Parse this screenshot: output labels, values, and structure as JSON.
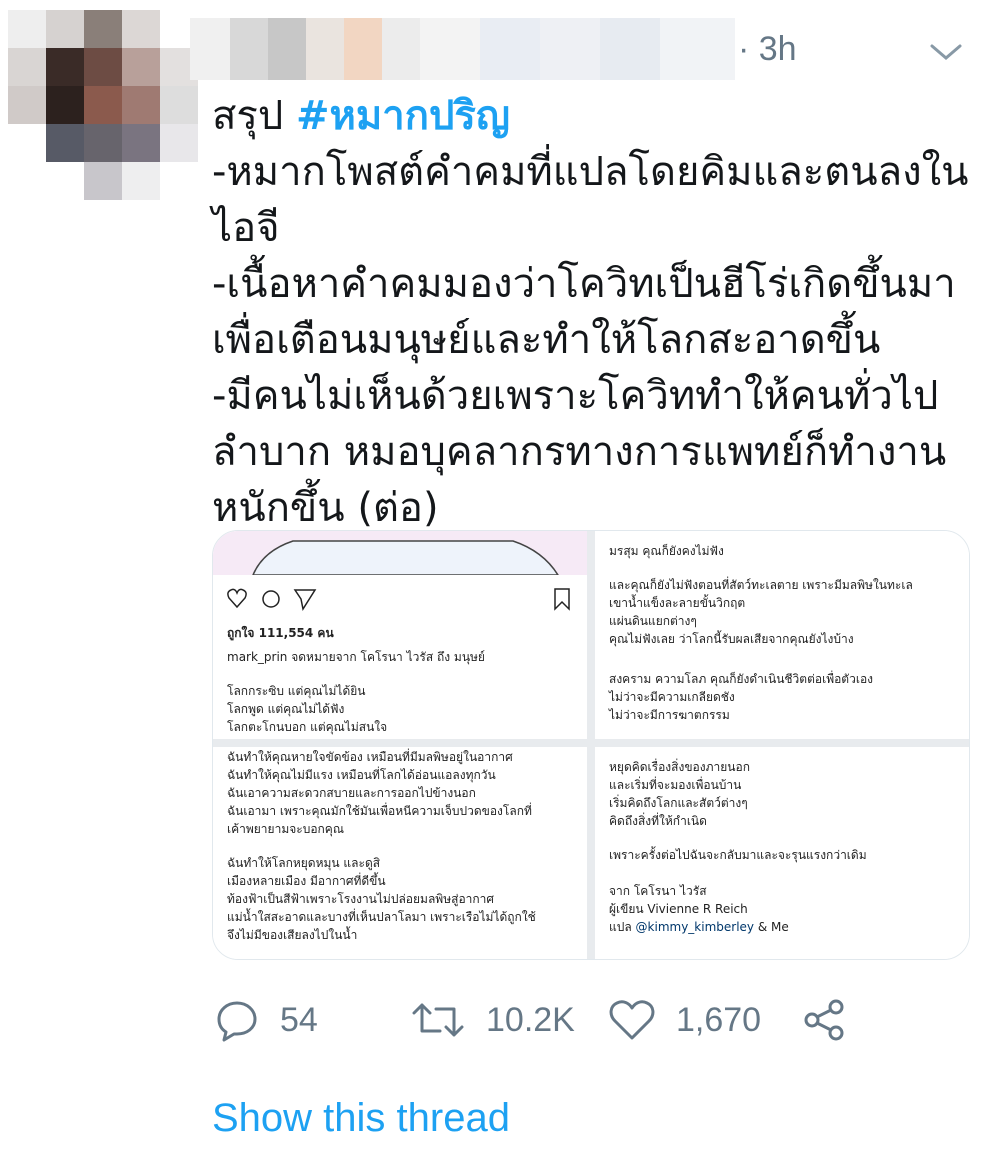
{
  "tweet": {
    "time": "· 3h",
    "text_prefix": "สรุป ",
    "hashtag": "#หมากปริญ",
    "lines": [
      "-หมากโพสต์คำคมที่แปลโดยคิมและตนลงใน",
      "ไอจี",
      "-เนื้อหาคำคมมองว่าโควิทเป็นฮีโร่เกิดขึ้นมา",
      "เพื่อเตือนมนุษย์และทำให้โลกสะอาดขึ้น",
      "-มีคนไม่เห็นด้วยเพราะโควิททำให้คนทั่วไป",
      "ลำบาก หมอบุคลากรทางการแพทย์ก็ทำงาน",
      "หนักขึ้น (ต่อ)"
    ]
  },
  "media": {
    "panel1": {
      "likes": "ถูกใจ 111,554 คน",
      "caption": "mark_prin จดหมายจาก โคโรนา ไวรัส ถึง มนุษย์",
      "lines": [
        "โลกกระซิบ แต่คุณไม่ได้ยิน",
        "โลกพูด แต่คุณไม่ได้ฟัง",
        "โลกตะโกนบอก แต่คุณไม่สนใจ"
      ]
    },
    "panel2": {
      "lines": [
        "มรสุม คุณก็ยังคงไม่ฟัง",
        "",
        "และคุณก็ยังไม่ฟังตอนที่สัตว์ทะเลตาย เพราะมีมลพิษในทะเล",
        "เขาน้ำแข็งละลายขั้นวิกฤต",
        "แผ่นดินแยกต่างๆ",
        "คุณไม่ฟังเลย ว่าโลกนี้รับผลเสียจากคุณยังไงบ้าง",
        "",
        "สงคราม ความโลภ คุณก็ยังดำเนินชีวิตต่อเพื่อตัวเอง",
        "ไม่ว่าจะมีความเกลียดชัง",
        "ไม่ว่าจะมีการฆาตกรรม"
      ]
    },
    "panel3": {
      "lines": [
        "ฉันทำให้คุณหายใจขัดข้อง เหมือนที่มีมลพิษอยู่ในอากาศ",
        "ฉันทำให้คุณไม่มีแรง เหมือนที่โลกได้อ่อนแอลงทุกวัน",
        "ฉันเอาความสะดวกสบายและการออกไปข้างนอก",
        "ฉันเอามา เพราะคุณมักใช้มันเพื่อหนีความเจ็บปวดของโลกที่",
        "เค้าพยายามจะบอกคุณ",
        "",
        "ฉันทำให้โลกหยุดหมุน และดูสิ",
        "เมืองหลายเมือง มีอากาศที่ดีขึ้น",
        "ท้องฟ้าเป็นสีฟ้าเพราะโรงงานไม่ปล่อยมลพิษสู่อากาศ",
        "แม่น้ำใสสะอาดและบางที่เห็นปลาโลมา เพราะเรือไม่ได้ถูกใช้",
        "จึงไม่มีของเสียลงไปในน้ำ"
      ]
    },
    "panel4": {
      "lines": [
        "หยุดคิดเรื่องสิ่งของภายนอก",
        "และเริ่มที่จะมองเพื่อนบ้าน",
        "เริ่มคิดถึงโลกและสัตว์ต่างๆ",
        "คิดถึงสิ่งที่ให้กำเนิด",
        "",
        "เพราะครั้งต่อไปฉันจะกลับมาและจะรุนแรงกว่าเดิม",
        "",
        "จาก โคโรนา ไวรัส",
        "ผู้เขียน Vivienne R Reich"
      ],
      "credit_prefix": "แปล ",
      "credit_mention": "@kimmy_kimberley",
      "credit_suffix": " & Me"
    }
  },
  "actions": {
    "replies": "54",
    "retweets": "10.2K",
    "likes": "1,670"
  },
  "show_thread": "Show this thread",
  "colors": {
    "accent": "#1da1f2",
    "muted": "#657786",
    "text": "#14171a"
  },
  "icons": [
    "reply-icon",
    "retweet-icon",
    "like-icon",
    "share-icon",
    "chevron-down-icon",
    "heart-icon",
    "comment-icon",
    "send-icon",
    "bookmark-icon"
  ]
}
